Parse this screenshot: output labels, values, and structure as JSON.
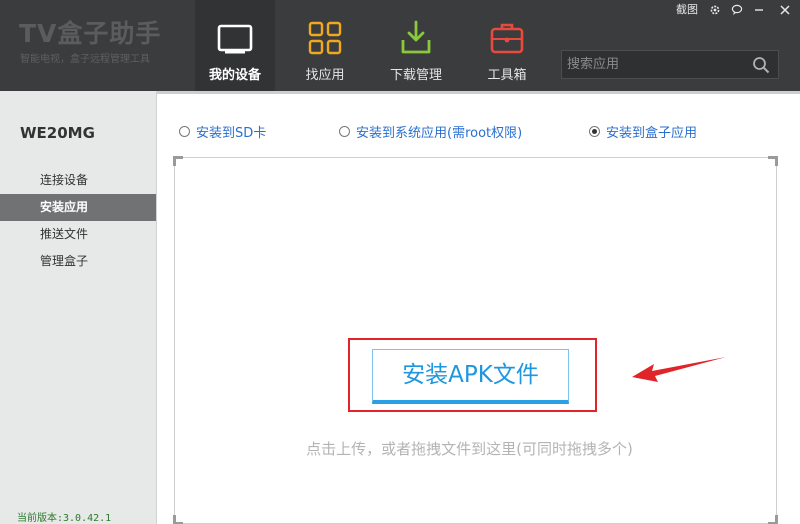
{
  "app": {
    "title": "TV盒子助手",
    "subtitle": "智能电视，盒子远程管理工具"
  },
  "top_links": {
    "screenshot": "截图"
  },
  "nav": [
    {
      "label": "我的设备",
      "icon": "tablet-icon",
      "active": true
    },
    {
      "label": "找应用",
      "icon": "grid-icon",
      "active": false
    },
    {
      "label": "下载管理",
      "icon": "download-icon",
      "active": false
    },
    {
      "label": "工具箱",
      "icon": "toolbox-icon",
      "active": false
    }
  ],
  "search": {
    "placeholder": "搜索应用"
  },
  "sidebar": {
    "device_name": "WE20MG",
    "items": [
      {
        "label": "连接设备",
        "active": false
      },
      {
        "label": "安装应用",
        "active": true
      },
      {
        "label": "推送文件",
        "active": false
      },
      {
        "label": "管理盒子",
        "active": false
      }
    ],
    "version": "当前版本:3.0.42.1"
  },
  "install_options": [
    {
      "label": "安装到SD卡",
      "checked": false
    },
    {
      "label": "安装到系统应用(需root权限)",
      "checked": false
    },
    {
      "label": "安装到盒子应用",
      "checked": true
    }
  ],
  "main": {
    "install_button": "安装APK文件",
    "hint": "点击上传，或者拖拽文件到这里(可同时拖拽多个)"
  },
  "colors": {
    "header_bg": "#3b3c3e",
    "accent_blue": "#1e96e0",
    "highlight_red": "#e0242a",
    "radio_text": "#2a6fd0"
  }
}
